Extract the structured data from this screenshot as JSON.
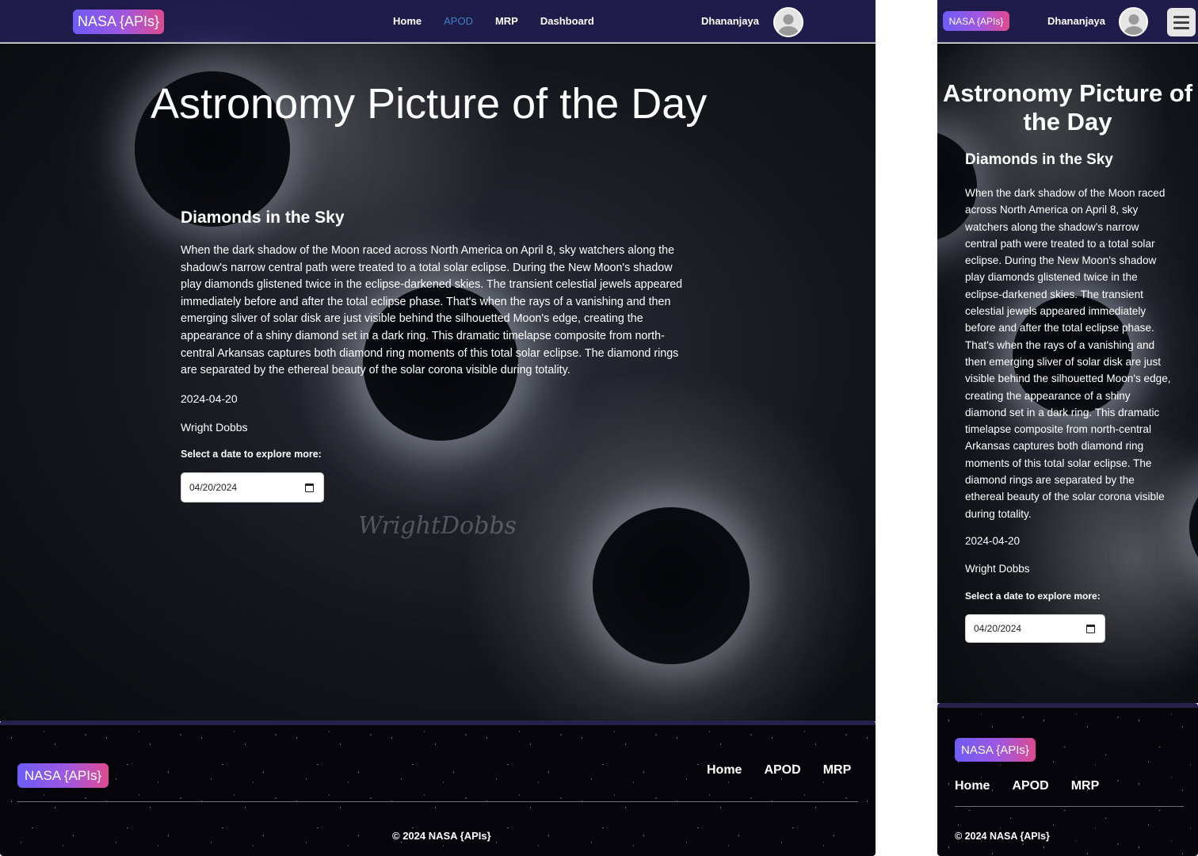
{
  "brand": {
    "name": "NASA {APIs}"
  },
  "navbar": {
    "links": [
      "Home",
      "APOD",
      "MRP",
      "Dashboard"
    ],
    "active": "APOD",
    "username": "Dhananjaya"
  },
  "page": {
    "title": "Astronomy Picture of the Day"
  },
  "apod": {
    "title": "Diamonds in the Sky",
    "explanation": "When the dark shadow of the Moon raced across North America on April 8, sky watchers along the shadow's narrow central path were treated to a total solar eclipse. During the New Moon's shadow play diamonds glistened twice in the eclipse-darkened skies. The transient celestial jewels appeared immediately before and after the total eclipse phase. That's when the rays of a vanishing and then emerging sliver of solar disk are just visible behind the silhouetted Moon's edge, creating the appearance of a shiny diamond set in a dark ring. This dramatic timelapse composite from north-central Arkansas captures both diamond ring moments of this total solar eclipse. The diamond rings are separated by the ethereal beauty of the solar corona visible during totality.",
    "date": "2024-04-20",
    "copyright": "Wright Dobbs",
    "image_watermark": "WrightDobbs"
  },
  "date_picker": {
    "label": "Select a date to explore more:",
    "value": "04/20/2024"
  },
  "footer": {
    "links": [
      "Home",
      "APOD",
      "MRP"
    ],
    "copyright": "© 2024 NASA {APIs}"
  },
  "colors": {
    "navbar_bg": "#1f1b4a",
    "active_link": "#3b82c4",
    "brand_gradient_start": "#6d5cf6",
    "brand_gradient_end": "#e04a8f"
  },
  "icons": [
    "user-avatar-icon",
    "calendar-icon",
    "hamburger-menu-icon"
  ]
}
